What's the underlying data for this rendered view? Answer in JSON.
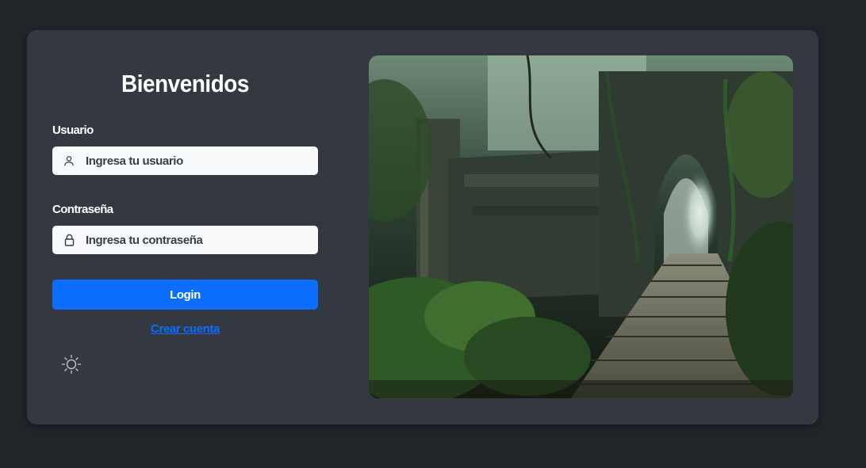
{
  "login": {
    "title": "Bienvenidos",
    "username_label": "Usuario",
    "username_placeholder": "Ingresa tu usuario",
    "password_label": "Contraseña",
    "password_placeholder": "Ingresa tu contraseña",
    "login_button": "Login",
    "create_account_link": "Crear cuenta",
    "theme_toggle_icon": "sun-icon",
    "user_icon": "user-icon",
    "lock_icon": "lock-icon"
  },
  "colors": {
    "page_background": "#212429",
    "card_background": "#343841",
    "accent": "#0d6efd",
    "input_background": "#f8f9fa"
  },
  "hero_image": {
    "subject": "jungle-ruins-stone-archway-with-stairs"
  }
}
